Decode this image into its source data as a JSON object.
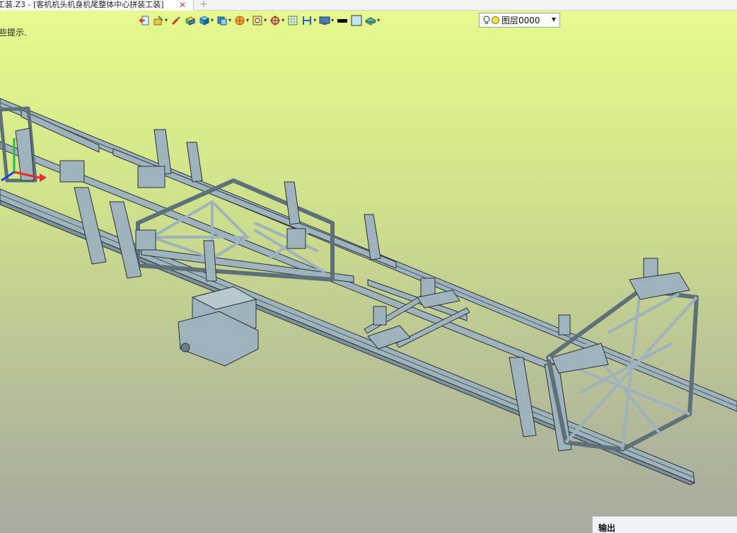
{
  "window": {
    "tab_title": "工装.Z3 - [客机机头机身机尾整体中心拼装工装]",
    "close_glyph": "✕",
    "new_tab_glyph": "+"
  },
  "viewport": {
    "hint_text": "些提示."
  },
  "toolbar": {
    "items": [
      {
        "icon": "exit-sketch-icon",
        "dropdown": false
      },
      {
        "icon": "feature-tools-icon",
        "dropdown": true
      },
      {
        "icon": "brush-icon",
        "dropdown": false
      },
      {
        "icon": "shaded-solid-icon",
        "dropdown": false
      },
      {
        "icon": "solid-box-icon",
        "dropdown": true
      },
      {
        "icon": "view-cube-icon",
        "dropdown": true
      },
      {
        "icon": "render-sphere-icon",
        "dropdown": true
      },
      {
        "icon": "zoom-window-icon",
        "dropdown": true
      },
      {
        "icon": "snap-target-icon",
        "dropdown": true
      },
      {
        "icon": "grid-icon",
        "dropdown": false
      },
      {
        "icon": "dimension-icon",
        "dropdown": true
      },
      {
        "icon": "display-settings-icon",
        "dropdown": true
      },
      {
        "icon": "line-color-icon",
        "dropdown": false
      },
      {
        "icon": "face-color-icon",
        "dropdown": false
      },
      {
        "icon": "layer-stack-icon",
        "dropdown": true
      }
    ],
    "layer_select": {
      "value": "图层0000"
    }
  },
  "output_panel": {
    "title": "输出"
  },
  "colors": {
    "model_fill": "#9fb3bc",
    "model_edge": "#2b3338",
    "background_top": "#e7f98e",
    "background_bottom": "#a9ab9e"
  }
}
